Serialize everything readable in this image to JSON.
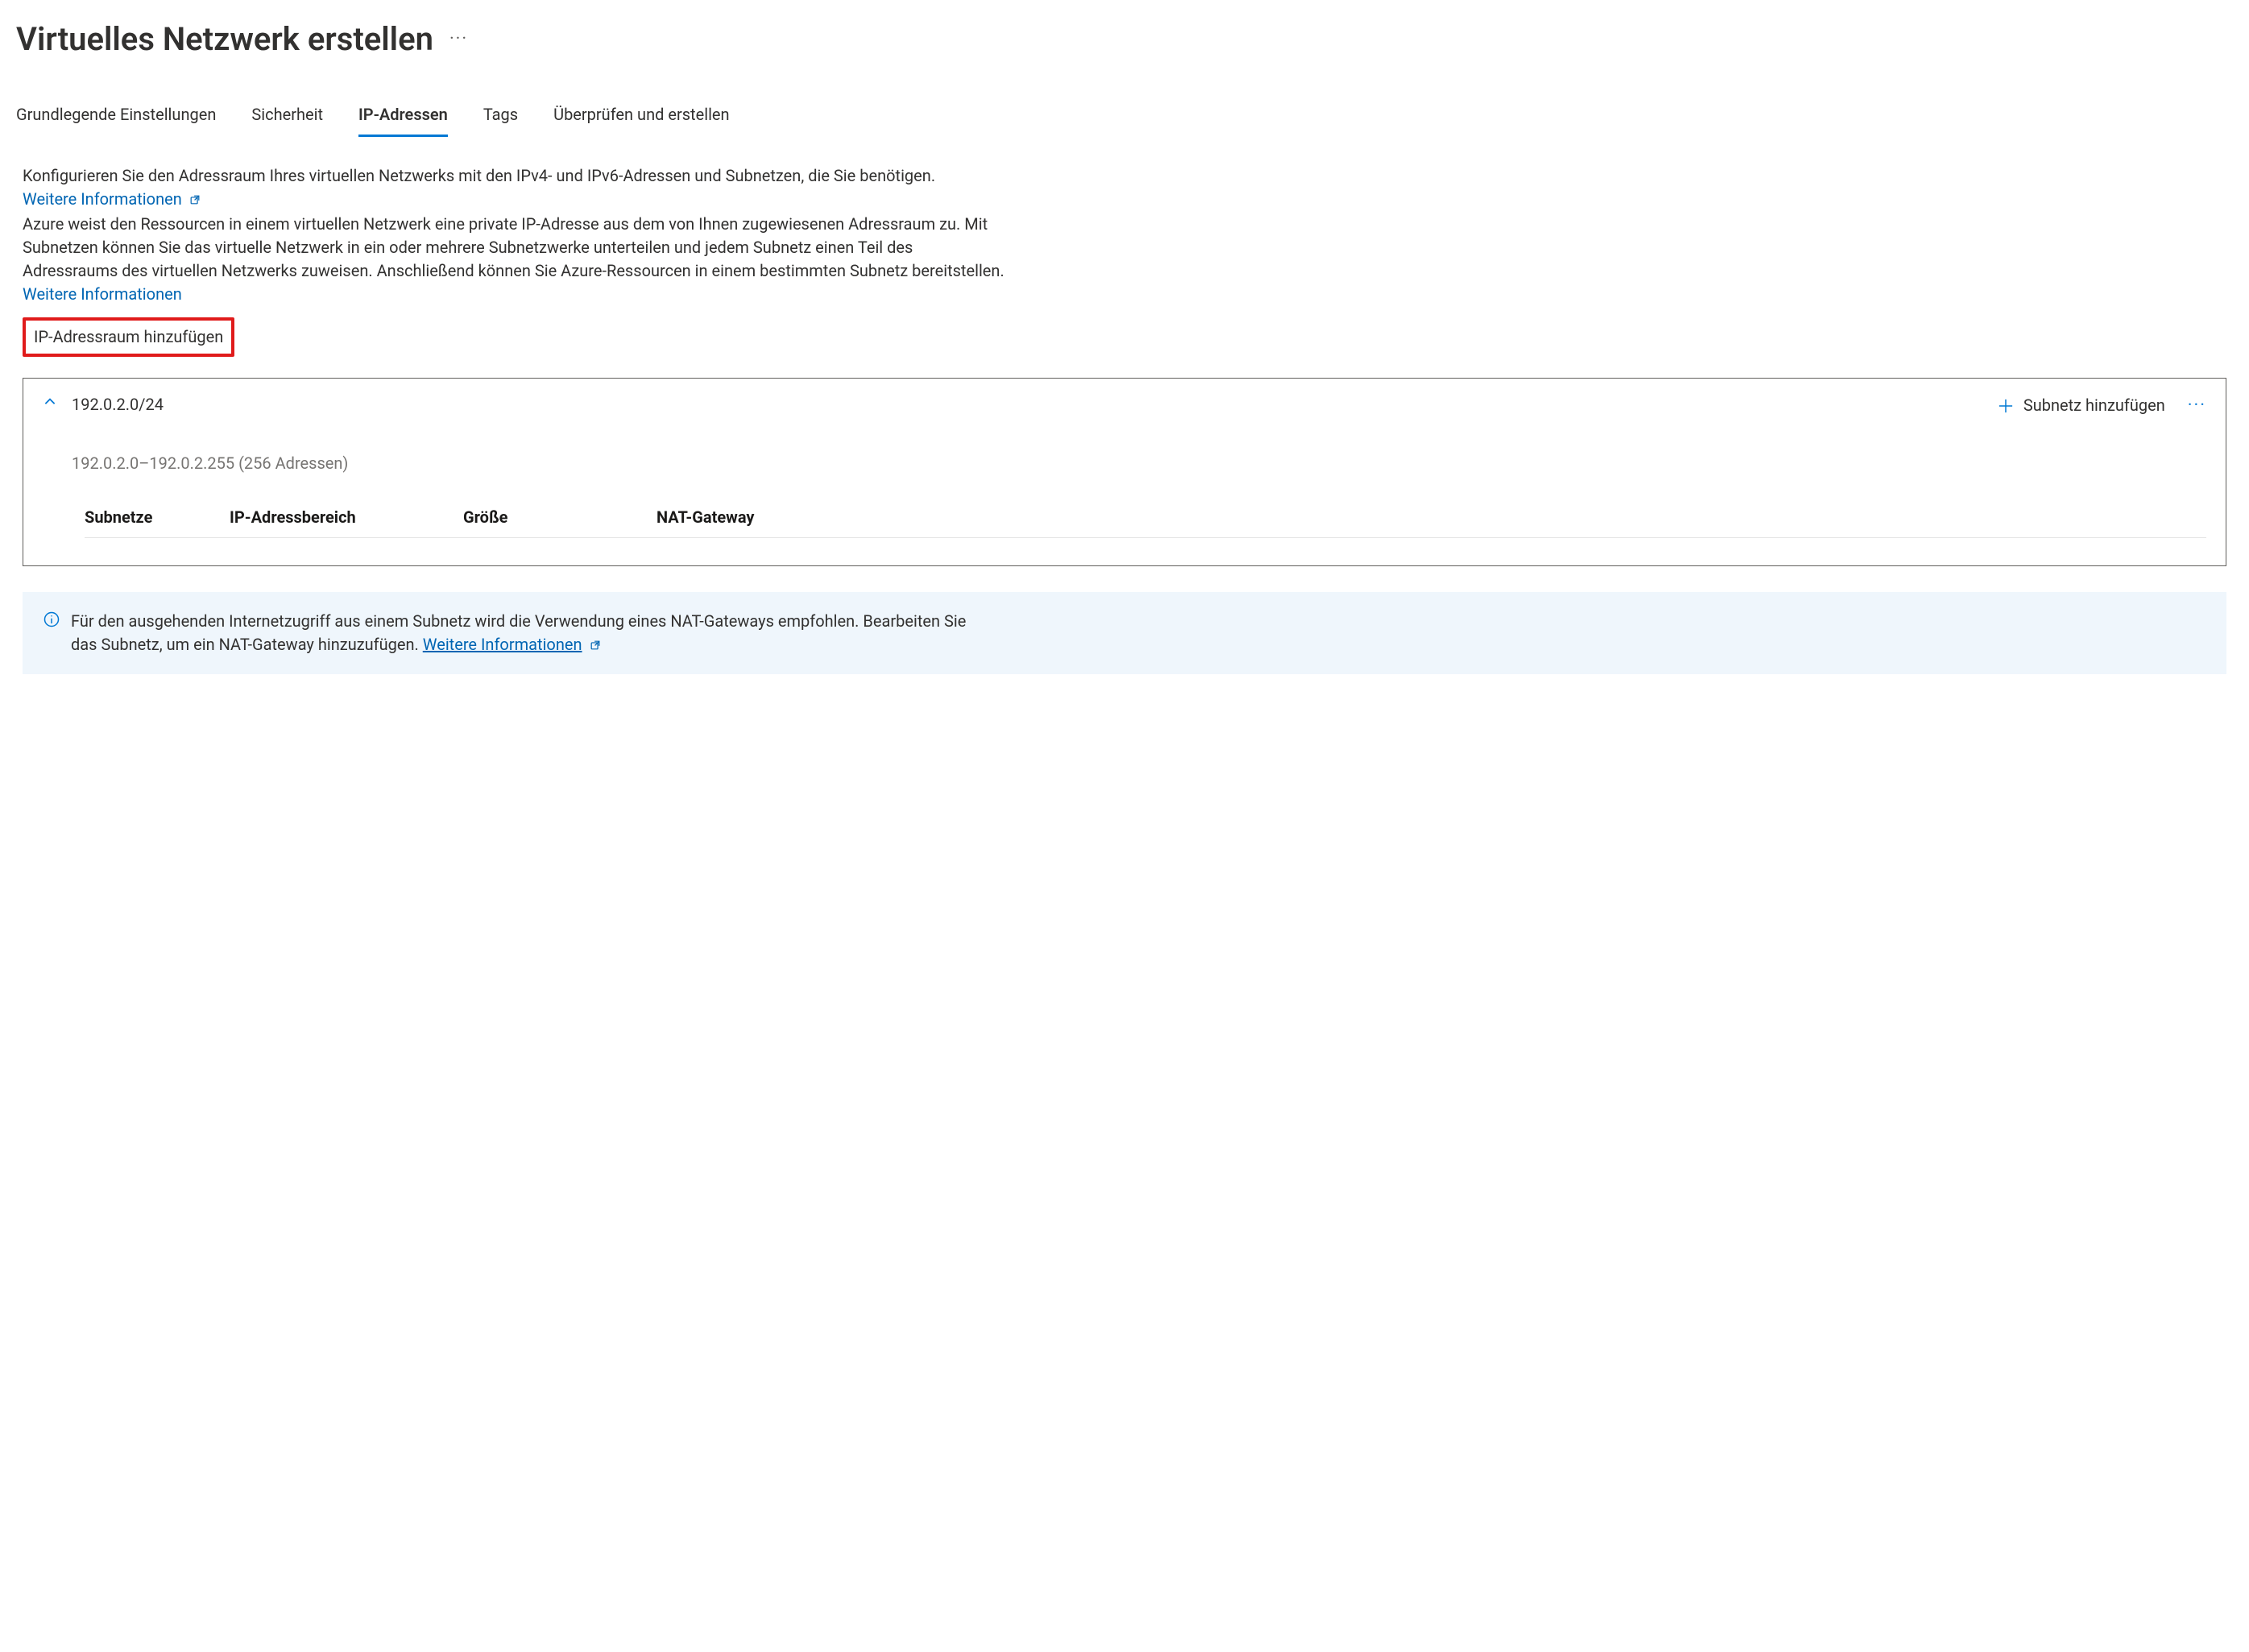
{
  "header": {
    "title": "Virtuelles Netzwerk erstellen"
  },
  "tabs": {
    "basic": "Grundlegende Einstellungen",
    "security": "Sicherheit",
    "ip": "IP-Adressen",
    "tags": "Tags",
    "review": "Überprüfen und erstellen"
  },
  "description": {
    "p1": "Konfigurieren Sie den Adressraum Ihres virtuellen Netzwerks mit den IPv4- und IPv6-Adressen und Subnetzen, die Sie benötigen.",
    "learn1": "Weitere Informationen",
    "p2": "Azure weist den Ressourcen in einem virtuellen Netzwerk eine private IP-Adresse aus dem von Ihnen zugewiesenen Adressraum zu. Mit Subnetzen können Sie das virtuelle Netzwerk in ein oder mehrere Subnetzwerke unterteilen und jedem Subnetz einen Teil des Adressraums des virtuellen Netzwerks zuweisen. Anschließend können Sie Azure-Ressourcen in einem bestimmten Subnetz bereitstellen.",
    "learn2": "Weitere Informationen"
  },
  "buttons": {
    "add_ip_space": "IP-Adressraum hinzufügen",
    "add_subnet": "Subnetz hinzufügen"
  },
  "address_space": {
    "cidr": "192.0.2.0/24",
    "range": "192.0.2.0–192.0.2.255 (256 Adressen)"
  },
  "table": {
    "col_subnets": "Subnetze",
    "col_range": "IP-Adressbereich",
    "col_size": "Größe",
    "col_nat": "NAT-Gateway"
  },
  "info": {
    "text": "Für den ausgehenden Internetzugriff aus einem Subnetz wird die Verwendung eines NAT-Gateways empfohlen. Bearbeiten Sie das Subnetz, um ein NAT-Gateway hinzuzufügen.",
    "learn": "Weitere Informationen"
  }
}
